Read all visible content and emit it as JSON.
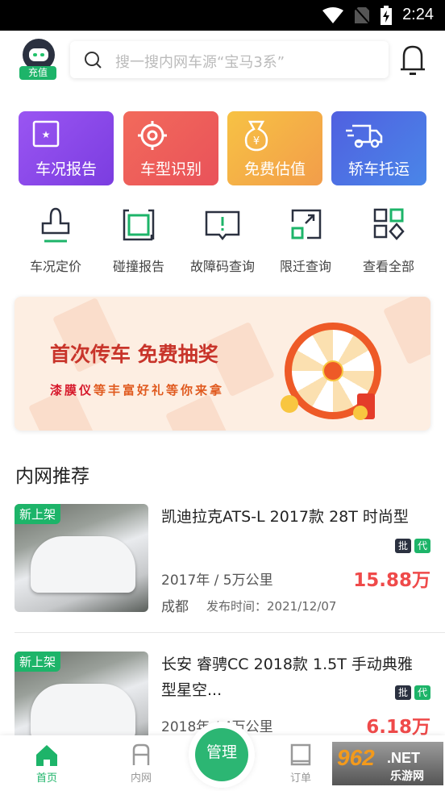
{
  "status_bar": {
    "time": "2:24",
    "icons": [
      "wifi-icon",
      "no-sim-icon",
      "battery-charging-icon"
    ]
  },
  "header": {
    "recharge_label": "充值",
    "search_placeholder": "搜一搜内网车源“宝马3系”",
    "icons": [
      "avatar",
      "search-icon",
      "bell-icon"
    ]
  },
  "tiles": [
    {
      "label": "车况报告",
      "icon": "report-star-icon",
      "color": "#8e4ef0"
    },
    {
      "label": "车型识别",
      "icon": "target-icon",
      "color": "#ee5c55"
    },
    {
      "label": "免费估值",
      "icon": "money-bag-icon",
      "color": "#f5b542"
    },
    {
      "label": "轿车托运",
      "icon": "truck-icon",
      "color": "#4a6be0"
    }
  ],
  "quick": [
    {
      "label": "车况定价",
      "icon": "stamp-icon"
    },
    {
      "label": "碰撞报告",
      "icon": "collision-icon"
    },
    {
      "label": "故障码查询",
      "icon": "alert-message-icon"
    },
    {
      "label": "限迁查询",
      "icon": "expand-icon"
    },
    {
      "label": "查看全部",
      "icon": "grid-icon"
    }
  ],
  "banner": {
    "title": "首次传车 免费抽奖",
    "sub_highlight": "漆膜仪",
    "sub_rest": "等丰富好礼等你来拿"
  },
  "section_title": "内网推荐",
  "listings": [
    {
      "tag": "新上架",
      "title": "凯迪拉克ATS-L 2017款 28T 时尚型",
      "badges": [
        "批",
        "代"
      ],
      "spec": "2017年 / 5万公里",
      "price": "15.88万",
      "city": "成都",
      "published": "发布时间：2021/12/07"
    },
    {
      "tag": "新上架",
      "title": "长安 睿骋CC 2018款 1.5T 手动典雅型星空...",
      "badges": [
        "批",
        "代"
      ],
      "spec": "2018年 / 4万公里",
      "price": "6.18万"
    }
  ],
  "nav": {
    "items": [
      {
        "label": "首页",
        "active": true
      },
      {
        "label": "内网"
      },
      {
        "label": "订单"
      }
    ],
    "center_label": "管理"
  },
  "watermark": "962.NET 乐游网",
  "colors": {
    "accent": "#1db469",
    "price": "#ef4a4a"
  }
}
